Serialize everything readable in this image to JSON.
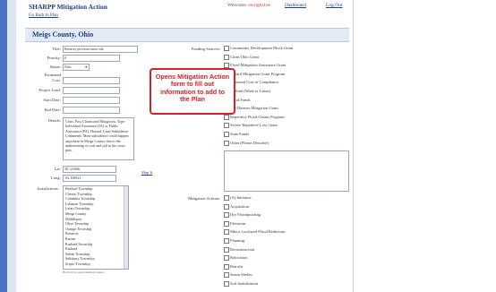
{
  "header": {
    "app_title": "SHARPP Mitigation Action",
    "welcome_label": "Welcome:",
    "welcome_user": "swright1oe",
    "dashboard_link": "Dashboard",
    "logout_link": "Log Out"
  },
  "back_link": "Go Back to Plan",
  "county_title": "Meigs County, Ohio",
  "form": {
    "title_label": "Title:",
    "title_value": "Remove previous mine sub",
    "priority_label": "Priority:",
    "priority_value": "0",
    "status_label": "Status:",
    "status_value": "New",
    "estimated_cost_label_1": "Estimated",
    "estimated_cost_label_2": "Cost:",
    "project_lead_label": "Project Lead:",
    "start_date_label": "Start Date:",
    "end_date_label": "End Date:",
    "details_label": "Details:",
    "details_value": "Class: Past Claims and Mitigation. Type: Individual Assistance (IA) or Public Assistance (PA). Hazard: Land Subsidence. Comments: Mine subsidence could happen anywhere in Meigs County due to the undermining of coal and salt in the years past.",
    "lat_label": "Lat:",
    "lat_value": "39.121666",
    "long_label": "Long:",
    "long_value": "-82.168923",
    "map_link": "Map It",
    "jurisdictions_label": "Jurisdictions:",
    "jurisdictions": [
      "Bedford Township",
      "Chester Township",
      "Columbia Township",
      "Lebanon Township",
      "Letart Township",
      "Meigs County",
      "Middleport",
      "Olive Township",
      "Orange Township",
      "Pomeroy",
      "Racine",
      "Rutland Township",
      "Rutland",
      "Salem Township",
      "Salisbury Township",
      "Scipio Township"
    ],
    "jurisdictions_hint": "Hold ctrl to select multiple values",
    "funding_label": "Funding Sources:",
    "funding_sources": [
      "Community Development Block Grant",
      "Clean Ohio Grant",
      "Flood Mitigation Assistance Grant",
      "Hazard Mitigation Grant Program",
      "Increased Cost of Compliance",
      "In-Kind (Work or Labor)",
      "Local Funds",
      "Pre-Disaster Mitigation Grant",
      "Repetitive Flood Claims Program",
      "Severe Repetitive Loss Grant",
      "State Funds",
      "Other (Please Describe)"
    ],
    "actions_label": "Mitigation Actions:",
    "mitigation_actions": [
      "(A) Initiative",
      "Acquisition",
      "Dry Floodproofing",
      "Elevation",
      "Minor Localized Flood Reduction",
      "Planning",
      "Reconstruction",
      "Relocation",
      "Retrofit",
      "Storm Shelter",
      "Soil Stabilization"
    ]
  },
  "callout_text": "Opens Mitigation Action form to fill out information to add to the Plan",
  "colors": {
    "accent": "#1f3f7a",
    "callout_red": "#d0232b",
    "sidebar_blue": "#4a73c4"
  }
}
